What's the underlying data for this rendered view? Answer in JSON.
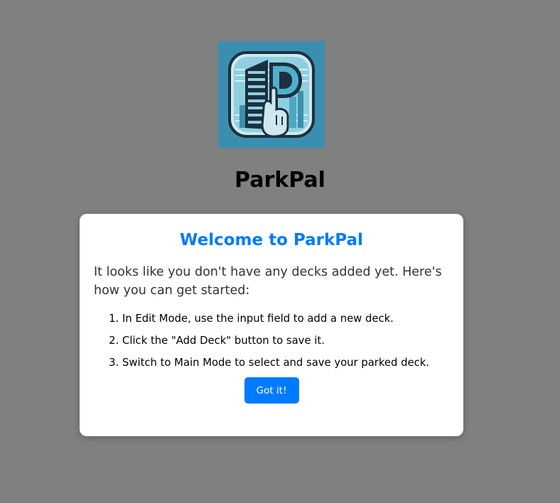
{
  "app": {
    "name": "ParkPal",
    "logo_icon": "parking-garage-logo-icon",
    "logo_letter": "P"
  },
  "modal": {
    "title": "Welcome to ParkPal",
    "intro": "It looks like you don't have any decks added yet. Here's how you can get started:",
    "steps": [
      "In Edit Mode, use the input field to add a new deck.",
      "Click the \"Add Deck\" button to save it.",
      "Switch to Main Mode to select and save your parked deck."
    ],
    "button_label": "Got it!"
  },
  "colors": {
    "backdrop": "#808080",
    "accent": "#007bff",
    "modal_bg": "#ffffff",
    "logo_teal": "#3a9dbd",
    "logo_dark": "#1d3040"
  }
}
